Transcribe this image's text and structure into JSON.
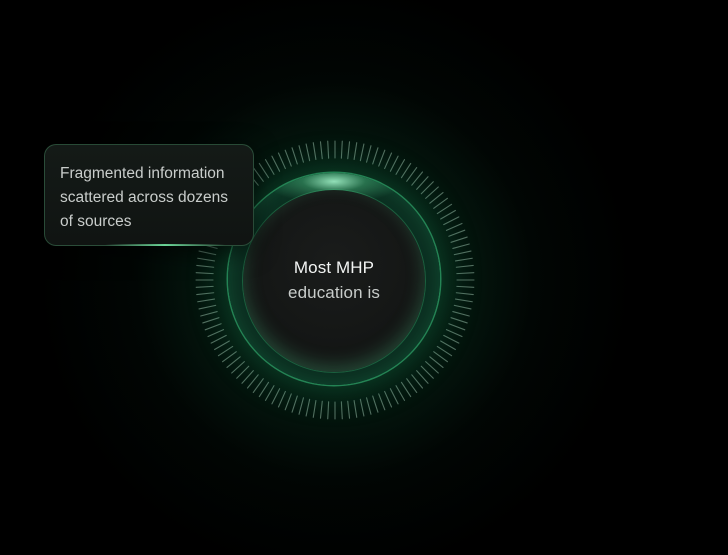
{
  "hero": {
    "center_line1": "Most MHP",
    "center_line2": "education is"
  },
  "tooltip": {
    "text": "Fragmented information scattered across dozens of sources"
  },
  "colors": {
    "accent_green": "#3cc882",
    "background": "#000000",
    "card": "#121614"
  }
}
